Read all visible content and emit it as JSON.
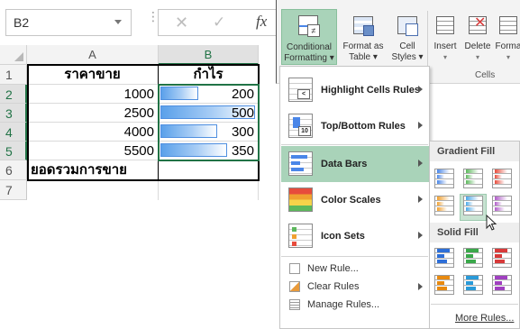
{
  "formula_bar": {
    "name_box": "B2",
    "fx": "fx"
  },
  "sheet": {
    "columns": [
      "A",
      "B"
    ],
    "rows": [
      "1",
      "2",
      "3",
      "4",
      "5",
      "6",
      "7"
    ],
    "header_a": "ราคาขาย",
    "header_b": "กำไร",
    "col_a": [
      "1000",
      "2500",
      "4000",
      "5500"
    ],
    "col_b": [
      "200",
      "500",
      "300",
      "350"
    ],
    "data_bar_fraction": [
      0.4,
      1.0,
      0.6,
      0.7
    ],
    "total_label": "ยอดรวมการขาย",
    "bar_color": "#5aa0ea"
  },
  "ribbon": {
    "conditional_formatting": [
      "Conditional",
      "Formatting ▾"
    ],
    "format_as_table": [
      "Format as",
      "Table ▾"
    ],
    "cell_styles": [
      "Cell",
      "Styles ▾"
    ],
    "insert": "Insert",
    "delete": "Delete",
    "format": "Forma",
    "cells_group": "Cells",
    "accent": "#a9d3b9"
  },
  "menu": {
    "highlight_cells_rules": "Highlight Cells Rules",
    "top_bottom_rules": "Top/Bottom Rules",
    "data_bars": "Data Bars",
    "color_scales": "Color Scales",
    "icon_sets": "Icon Sets",
    "new_rule": "New Rule...",
    "clear_rules": "Clear Rules",
    "manage_rules": "Manage Rules..."
  },
  "submenu": {
    "gradient_fill": "Gradient Fill",
    "solid_fill": "Solid Fill",
    "more_rules": "More Rules...",
    "gradient_colors": [
      "#4a86e8",
      "#5cb85c",
      "#e74c3c",
      "#f0a030",
      "#4aa8e8",
      "#b05cc8"
    ],
    "solid_colors": [
      "#2e6fd8",
      "#3aa84a",
      "#d83a3a",
      "#e88a10",
      "#2a9ad8",
      "#a040c0"
    ]
  }
}
